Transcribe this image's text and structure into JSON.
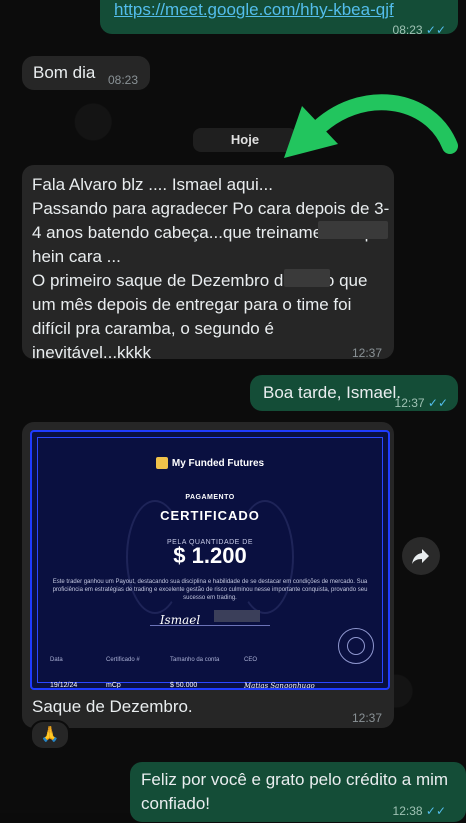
{
  "messages": {
    "link": {
      "text": "https://meet.google.com/hhy-kbea-qjf",
      "time": "08:23"
    },
    "bom_dia": {
      "text": "Bom dia",
      "time": "08:23"
    },
    "day_divider": "Hoje",
    "long": {
      "text": "Fala Alvaro blz .... Ismael aqui...\nPassando para agradecer Po cara depois de 3-4 anos batendo cabeça...que treinamento top hein cara ...\nO primeiro saque de Dezembro de        acho que um mês depois de entregar para o time foi difícil pra caramba, o segundo é inevitável...kkkk",
      "time": "12:37"
    },
    "boa_tarde": {
      "text": "Boa tarde, Ismael.",
      "time": "12:37"
    },
    "certificate_msg": {
      "caption": "Saque de Dezembro.",
      "time": "12:37",
      "reaction": "🙏"
    },
    "feliz": {
      "text": "Feliz por você e grato pelo crédito a mim\nconfiado!",
      "time": "12:38"
    }
  },
  "certificate": {
    "brand": "My Funded Futures",
    "heading": "PAGAMENTO",
    "title": "CERTIFICADO",
    "quantity_label": "PELA QUANTIDADE DE",
    "amount": "$ 1.200",
    "description": "Este trader ganhou um Payout, destacando sua disciplina e habilidade de se destacar em condições de mercado. Sua proficiência em estratégias de trading e excelente gestão de risco culminou nesse importante conquista, provando seu sucesso em trading.",
    "signature": "Ismael",
    "date_label": "Data",
    "date_value": "19/12/24",
    "cert_label": "Certificado #",
    "cert_value": "mCp",
    "size_label": "Tamanho da conta",
    "size_value": "$ 50.000",
    "ceo_label": "CEO",
    "ceo_value": "Matias Sangonhugo"
  },
  "colors": {
    "incoming": "#262626",
    "outgoing": "#144d37",
    "ticks": "#53bdeb",
    "arrow": "#22c55e"
  },
  "icons": {
    "forward": "forward-arrow-icon",
    "ticks": "double-check-icon"
  }
}
